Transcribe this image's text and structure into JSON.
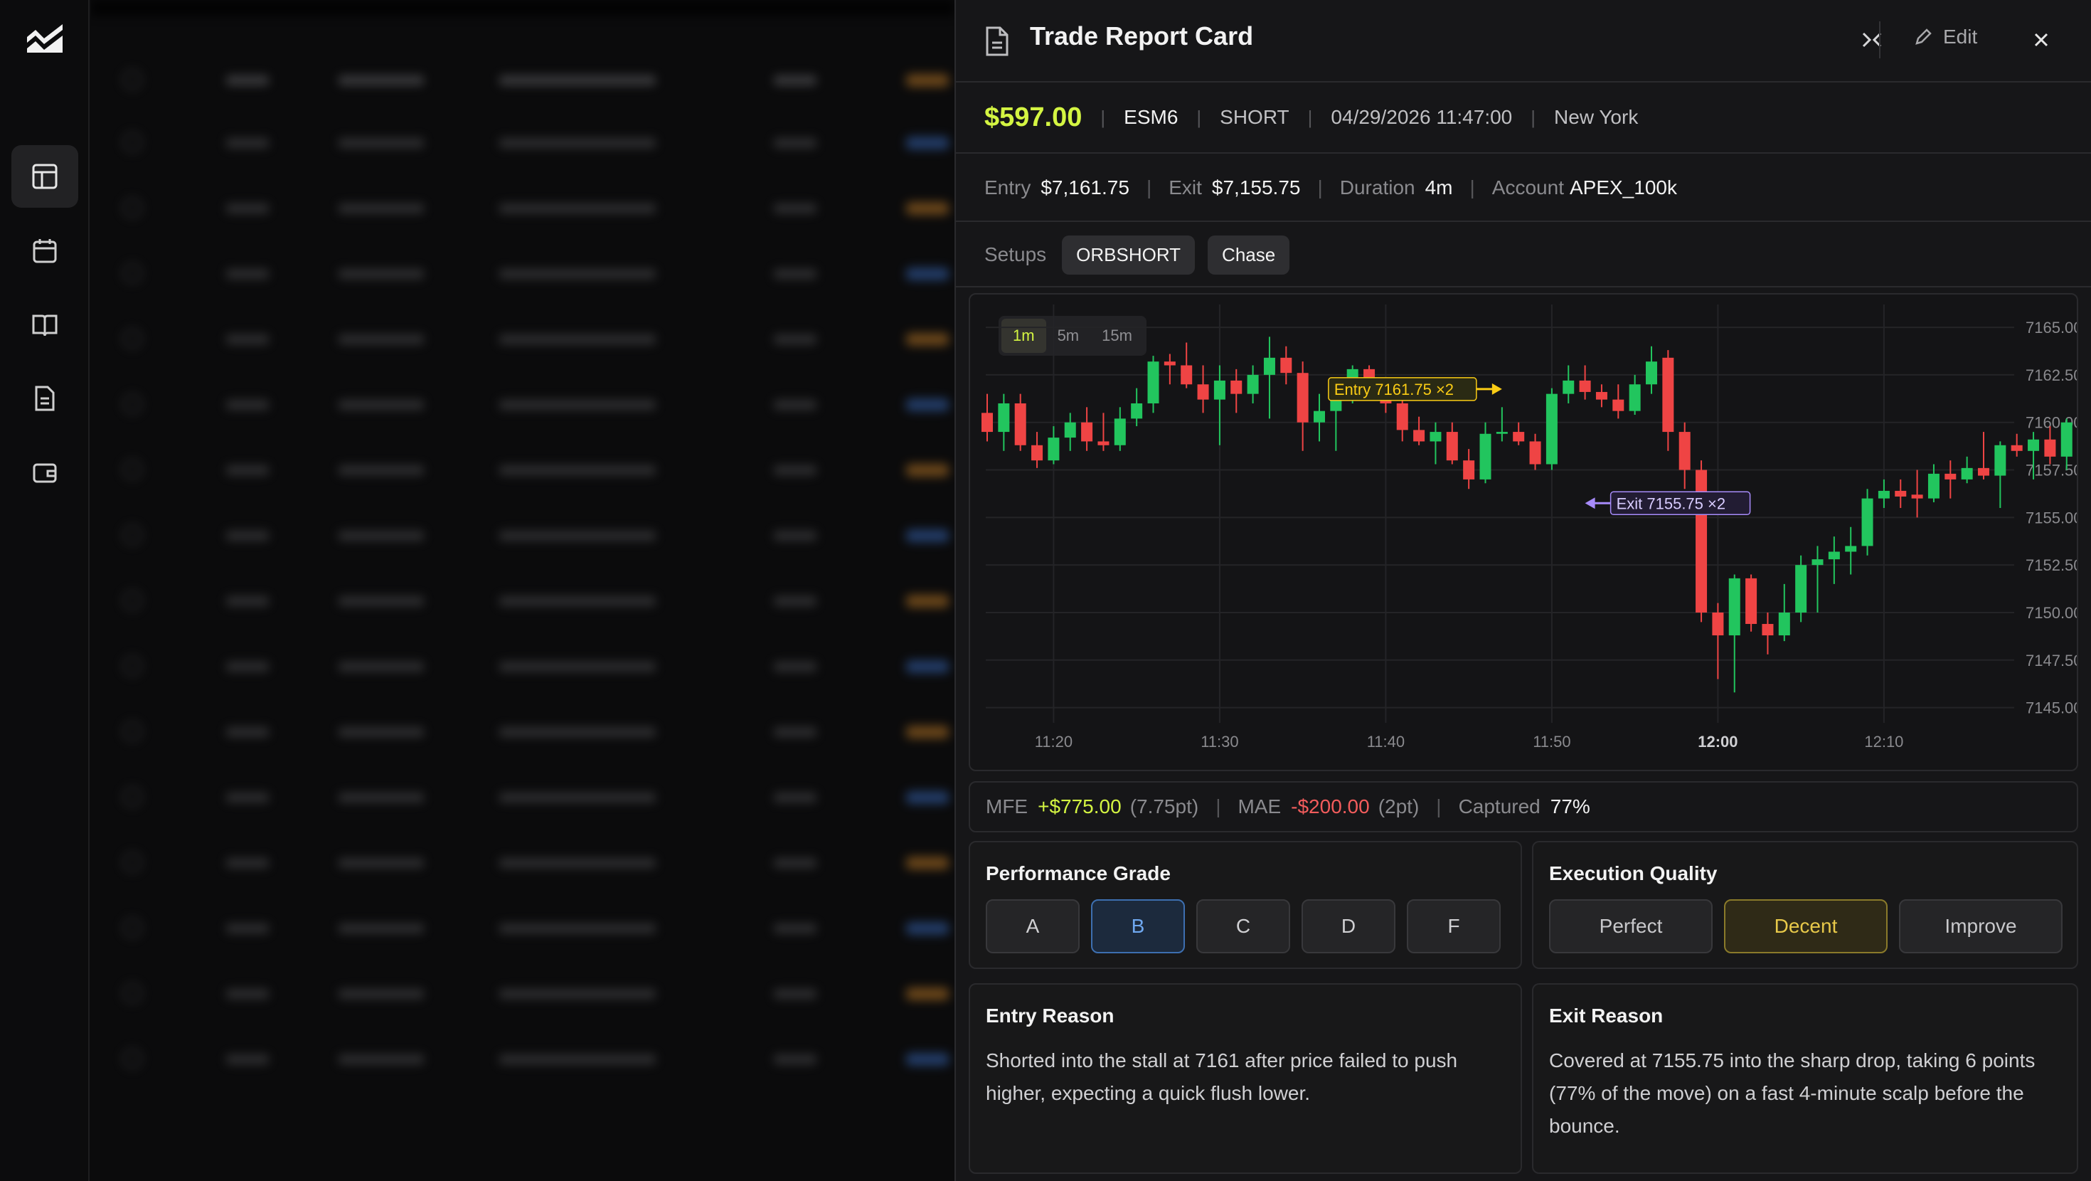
{
  "panel": {
    "title": "Trade Report Card",
    "edit_label": "Edit"
  },
  "summary": {
    "pnl": "$597.00",
    "symbol": "ESM6",
    "side": "SHORT",
    "datetime": "04/29/2026 11:47:00",
    "session": "New York"
  },
  "details": {
    "entry_label": "Entry",
    "entry_value": "$7,161.75",
    "exit_label": "Exit",
    "exit_value": "$7,155.75",
    "duration_label": "Duration",
    "duration_value": "4m",
    "account_label": "Account",
    "account_value": "APEX_100k"
  },
  "setups": {
    "label": "Setups",
    "tags": [
      "ORBSHORT",
      "Chase"
    ]
  },
  "timeframes": [
    "1m",
    "5m",
    "15m"
  ],
  "colors": {
    "accent": "#d4f542",
    "up": "#22c55e",
    "down": "#ef4444",
    "exit_marker": "#a78bfa"
  },
  "chart_data": {
    "type": "candlestick",
    "timeframe": "1m",
    "x_ticks": [
      "11:20",
      "11:30",
      "11:40",
      "11:50",
      "12:00",
      "12:10"
    ],
    "y_ticks": [
      "7165.00",
      "7162.50",
      "7160.00",
      "7157.50",
      "7155.00",
      "7152.50",
      "7150.00",
      "7147.50",
      "7145.00"
    ],
    "ylim": [
      7144.2,
      7166.2
    ],
    "grid": true,
    "start_time": "11:16",
    "candles": [
      [
        7160.5,
        7161.5,
        7159.0,
        7159.5
      ],
      [
        7159.5,
        7161.5,
        7158.5,
        7161.0
      ],
      [
        7161.0,
        7161.5,
        7158.5,
        7158.8
      ],
      [
        7158.8,
        7159.5,
        7157.6,
        7158.0
      ],
      [
        7158.0,
        7159.8,
        7157.8,
        7159.2
      ],
      [
        7159.2,
        7160.5,
        7158.5,
        7160.0
      ],
      [
        7160.0,
        7160.8,
        7158.5,
        7159.0
      ],
      [
        7159.0,
        7160.5,
        7158.5,
        7158.8
      ],
      [
        7158.8,
        7160.8,
        7158.5,
        7160.2
      ],
      [
        7160.2,
        7161.8,
        7159.8,
        7161.0
      ],
      [
        7161.0,
        7163.5,
        7160.5,
        7163.2
      ],
      [
        7163.2,
        7163.6,
        7162.0,
        7163.0
      ],
      [
        7163.0,
        7164.2,
        7161.8,
        7162.0
      ],
      [
        7162.0,
        7163.0,
        7160.5,
        7161.2
      ],
      [
        7161.2,
        7163.0,
        7158.8,
        7162.2
      ],
      [
        7162.2,
        7162.8,
        7160.5,
        7161.5
      ],
      [
        7161.5,
        7163.0,
        7161.0,
        7162.5
      ],
      [
        7162.5,
        7164.5,
        7160.2,
        7163.4
      ],
      [
        7163.4,
        7164.0,
        7162.0,
        7162.6
      ],
      [
        7162.6,
        7163.2,
        7158.5,
        7160.0
      ],
      [
        7160.0,
        7161.5,
        7159.0,
        7160.6
      ],
      [
        7160.6,
        7162.0,
        7158.5,
        7161.5
      ],
      [
        7161.5,
        7163.0,
        7161.0,
        7162.8
      ],
      [
        7162.8,
        7163.0,
        7161.5,
        7161.8
      ],
      [
        7161.8,
        7162.2,
        7160.5,
        7161.0
      ],
      [
        7161.0,
        7161.5,
        7159.0,
        7159.6
      ],
      [
        7159.6,
        7160.3,
        7158.8,
        7159.0
      ],
      [
        7159.0,
        7160.0,
        7157.8,
        7159.5
      ],
      [
        7159.5,
        7160.0,
        7157.8,
        7158.0
      ],
      [
        7158.0,
        7158.6,
        7156.5,
        7157.0
      ],
      [
        7157.0,
        7160.0,
        7156.8,
        7159.4
      ],
      [
        7159.4,
        7160.8,
        7159.0,
        7159.5
      ],
      [
        7159.5,
        7160.0,
        7158.8,
        7159.0
      ],
      [
        7159.0,
        7159.4,
        7157.5,
        7157.8
      ],
      [
        7157.8,
        7161.8,
        7157.5,
        7161.5
      ],
      [
        7161.5,
        7163.0,
        7161.0,
        7162.2
      ],
      [
        7162.2,
        7163.0,
        7161.2,
        7161.6
      ],
      [
        7161.6,
        7162.0,
        7160.8,
        7161.2
      ],
      [
        7161.2,
        7162.0,
        7160.2,
        7160.6
      ],
      [
        7160.6,
        7162.5,
        7160.4,
        7162.0
      ],
      [
        7162.0,
        7164.0,
        7161.5,
        7163.2
      ],
      [
        7163.4,
        7163.8,
        7158.5,
        7159.5
      ],
      [
        7159.5,
        7160.0,
        7156.5,
        7157.5
      ],
      [
        7157.5,
        7158.0,
        7149.5,
        7150.0
      ],
      [
        7150.0,
        7150.5,
        7146.5,
        7148.8
      ],
      [
        7148.8,
        7152.0,
        7145.8,
        7151.8
      ],
      [
        7151.8,
        7152.0,
        7149.0,
        7149.4
      ],
      [
        7149.4,
        7150.0,
        7147.8,
        7148.8
      ],
      [
        7148.8,
        7151.5,
        7148.5,
        7150.0
      ],
      [
        7150.0,
        7153.0,
        7149.5,
        7152.5
      ],
      [
        7152.5,
        7153.5,
        7150.0,
        7152.8
      ],
      [
        7152.8,
        7154.0,
        7151.5,
        7153.2
      ],
      [
        7153.2,
        7154.5,
        7152.0,
        7153.5
      ],
      [
        7153.5,
        7156.5,
        7153.0,
        7156.0
      ],
      [
        7156.0,
        7157.0,
        7155.5,
        7156.4
      ],
      [
        7156.4,
        7157.0,
        7155.5,
        7156.1
      ],
      [
        7156.2,
        7157.5,
        7155.0,
        7156.0
      ],
      [
        7156.0,
        7157.8,
        7155.8,
        7157.3
      ],
      [
        7157.3,
        7158.0,
        7156.0,
        7157.0
      ],
      [
        7157.0,
        7158.2,
        7156.8,
        7157.6
      ],
      [
        7157.6,
        7159.5,
        7157.0,
        7157.2
      ],
      [
        7157.2,
        7159.0,
        7155.5,
        7158.8
      ],
      [
        7158.8,
        7159.4,
        7158.2,
        7158.5
      ],
      [
        7158.5,
        7159.5,
        7157.0,
        7159.1
      ],
      [
        7159.1,
        7159.8,
        7157.8,
        7158.2
      ],
      [
        7158.2,
        7160.2,
        7157.5,
        7160.0
      ],
      [
        7160.0,
        7160.8,
        7157.7,
        7158.0
      ],
      [
        7158.0,
        7158.8,
        7157.2,
        7158.5
      ],
      [
        7158.5,
        7158.8,
        7157.2,
        7157.5
      ],
      [
        7157.5,
        7158.0,
        7155.2,
        7156.0
      ],
      [
        7156.0,
        7158.5,
        7155.5,
        7157.5
      ]
    ],
    "markers": [
      {
        "label": "Entry 7161.75 ×2",
        "price": 7161.75,
        "time": "11:47",
        "direction": "right",
        "color": "#facc15"
      },
      {
        "label": "Exit 7155.75 ×2",
        "price": 7155.75,
        "time": "11:52",
        "direction": "left",
        "color": "#a78bfa"
      }
    ]
  },
  "metrics": {
    "mfe_label": "MFE",
    "mfe_value": "+$775.00",
    "mfe_pts": "(7.75pt)",
    "mae_label": "MAE",
    "mae_value": "-$200.00",
    "mae_pts": "(2pt)",
    "captured_label": "Captured",
    "captured_value": "77%"
  },
  "performance_grade": {
    "title": "Performance Grade",
    "options": [
      "A",
      "B",
      "C",
      "D",
      "F"
    ],
    "selected": "B"
  },
  "execution_quality": {
    "title": "Execution Quality",
    "options": [
      "Perfect",
      "Decent",
      "Improve"
    ],
    "selected": "Decent"
  },
  "entry_reason": {
    "title": "Entry Reason",
    "text": "Shorted into the stall at 7161 after price failed to push higher, expecting a quick flush lower."
  },
  "exit_reason": {
    "title": "Exit Reason",
    "text": "Covered at 7155.75 into the sharp drop, taking 6 points (77% of the move) on a fast 4-minute scalp before the bounce."
  }
}
